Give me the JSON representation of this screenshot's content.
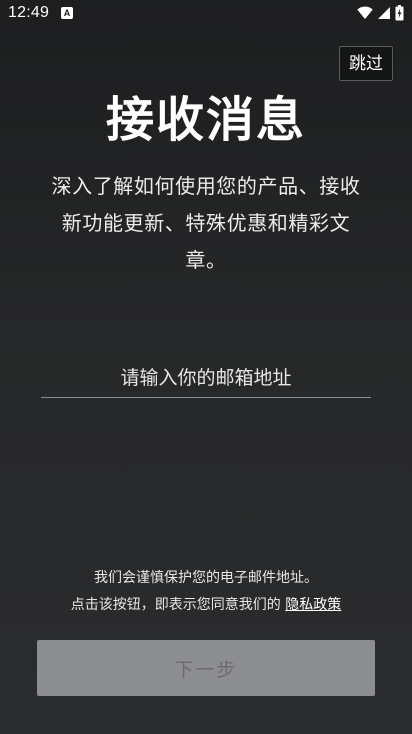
{
  "status_bar": {
    "time": "12:49",
    "notification_icon_glyph": "A",
    "icons": [
      "wifi-icon",
      "signal-icon",
      "battery-icon"
    ]
  },
  "header": {
    "skip_label": "跳过"
  },
  "main": {
    "title": "接收消息",
    "subtitle": "深入了解如何使用您的产品、接收新功能更新、特殊优惠和精彩文章。",
    "email_placeholder": "请输入你的邮箱地址"
  },
  "footer": {
    "privacy_line1": "我们会谨慎保护您的电子邮件地址。",
    "privacy_line2_prefix": "点击该按钮，即表示您同意我们的 ",
    "privacy_link": "隐私政策",
    "next_label": "下一步"
  },
  "colors": {
    "background": "#262728",
    "next_button_bg": "#8d8e90",
    "next_button_text": "#6a6b6d"
  }
}
